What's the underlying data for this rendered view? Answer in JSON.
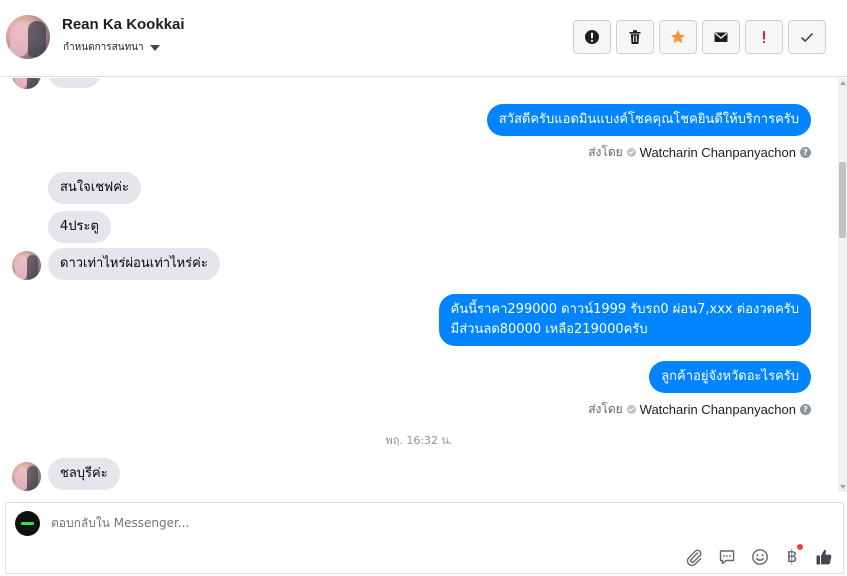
{
  "header": {
    "contact_name": "Rean Ka Kookkai",
    "settings_label": "กำหนดการสนทนา",
    "toolbar": [
      {
        "name": "mark-spam-button",
        "icon": "alert-circle-icon"
      },
      {
        "name": "delete-button",
        "icon": "trash-icon"
      },
      {
        "name": "star-button",
        "icon": "star-icon"
      },
      {
        "name": "mark-unread-button",
        "icon": "envelope-icon"
      },
      {
        "name": "important-button",
        "icon": "exclamation-icon"
      },
      {
        "name": "done-button",
        "icon": "checkmark-icon"
      }
    ]
  },
  "messages": {
    "out_1": "สวัสดีครับแอดมินแบงค์โชคคุณโชคยินดีให้บริการครับ",
    "in_1": "สนใจเชฟค่ะ",
    "in_2": "4ประตู",
    "in_3": "ดาวเท่าไหร่ผ่อนเท่าไหร่ค่ะ",
    "out_2_line1": "คันนี้ราคา299000 ดาวน์1999 รับรถ0 ผ่อน7,xxx ต่องวดครับ",
    "out_2_line2": "มีส่วนลด80000 เหลือ219000ครับ",
    "out_3": "ลูกค้าอยู่จังหวัดอะไรครับ",
    "timestamp": "พฤ. 16:32 น.",
    "in_4": "ชลบุรีค่ะ"
  },
  "sent_by": {
    "prefix": "ส่งโดย",
    "name": "Watcharin Chanpanyachon",
    "help": "?"
  },
  "composer": {
    "placeholder": "ตอบกลับใน Messenger...",
    "baht_symbol": "฿"
  },
  "colors": {
    "outgoing_bubble": "#0084ff",
    "incoming_bubble": "#e4e6eb",
    "star": "#f7923b",
    "important": "#e41e3f",
    "notification_dot": "#fa3e3e"
  }
}
